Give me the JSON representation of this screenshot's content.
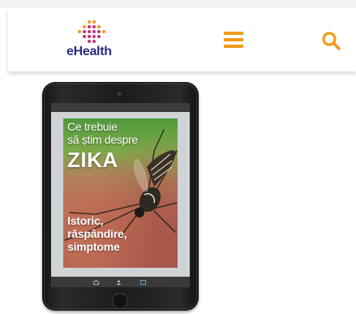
{
  "header": {
    "logo": {
      "wordmark": "eHealth",
      "subtitle": "",
      "icon": "ehealth-dots-icon",
      "colors": {
        "wordmark": "#2e2b86",
        "dots": [
          "#f29a1a",
          "#c0357a",
          "#2e2b86"
        ]
      }
    },
    "menu_icon": "hamburger-icon",
    "search_icon": "search-icon",
    "accent_color": "#f29a1a"
  },
  "article": {
    "device": "tablet",
    "cover": {
      "line1": "Ce trebuie",
      "line2": "să știm despre",
      "title": "ZIKA",
      "line4": "Istoric,",
      "line5": "răspândire,",
      "line6": "simptome"
    }
  }
}
